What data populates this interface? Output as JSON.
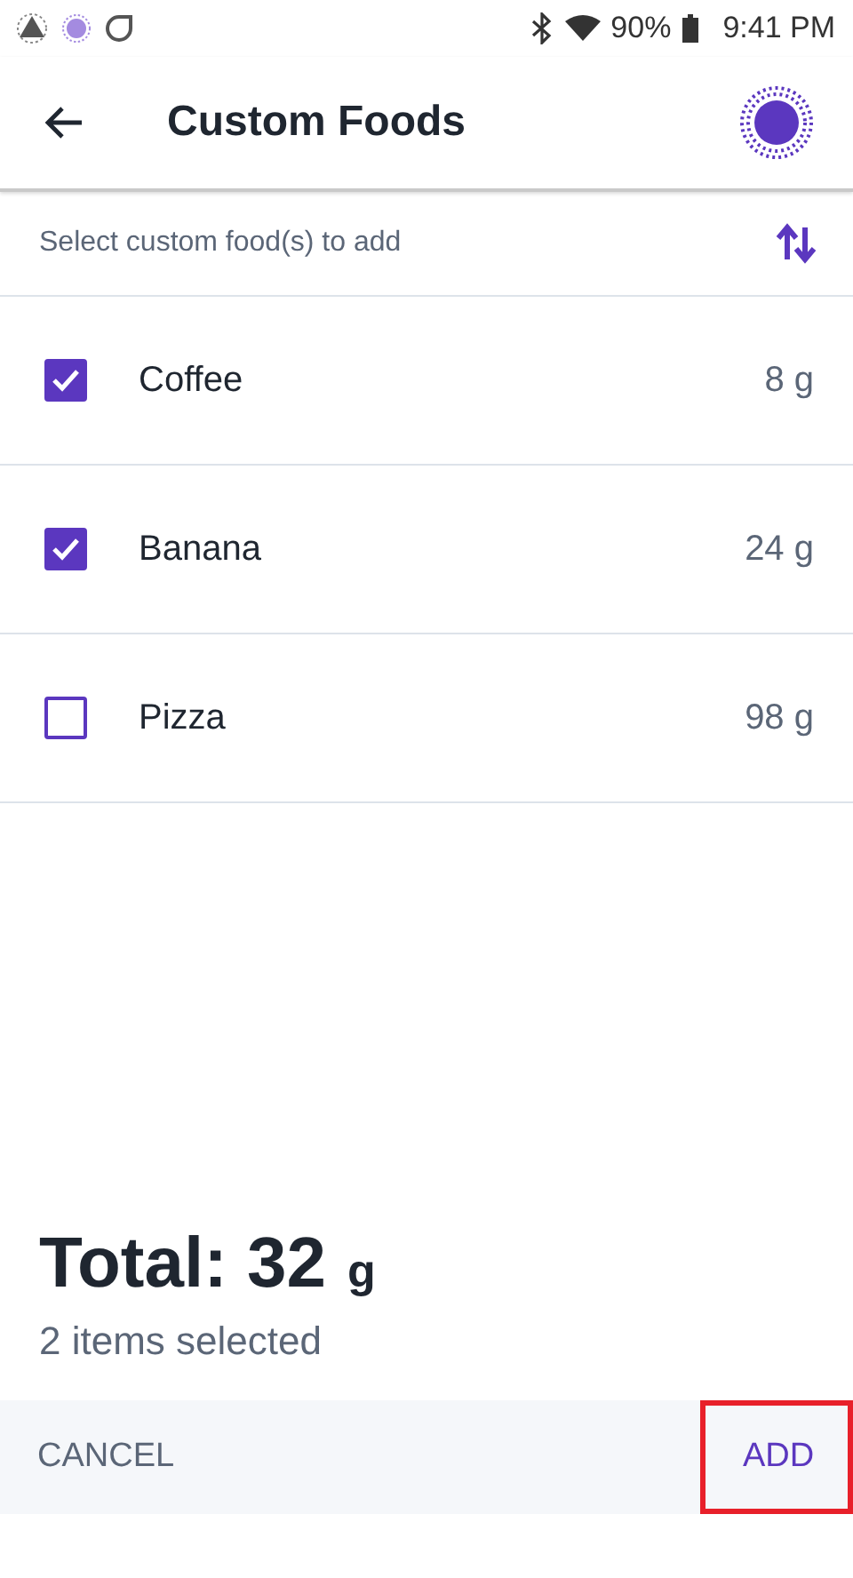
{
  "status_bar": {
    "battery": "90%",
    "time": "9:41 PM"
  },
  "header": {
    "title": "Custom Foods"
  },
  "subheader": {
    "text": "Select custom food(s) to add"
  },
  "foods": [
    {
      "name": "Coffee",
      "amount": "8 g",
      "checked": true
    },
    {
      "name": "Banana",
      "amount": "24 g",
      "checked": true
    },
    {
      "name": "Pizza",
      "amount": "98 g",
      "checked": false
    }
  ],
  "summary": {
    "total_label": "Total: 32",
    "unit": "g",
    "selected_count": "2 items selected"
  },
  "footer": {
    "cancel": "CANCEL",
    "add": "ADD",
    "add_highlighted": true
  }
}
